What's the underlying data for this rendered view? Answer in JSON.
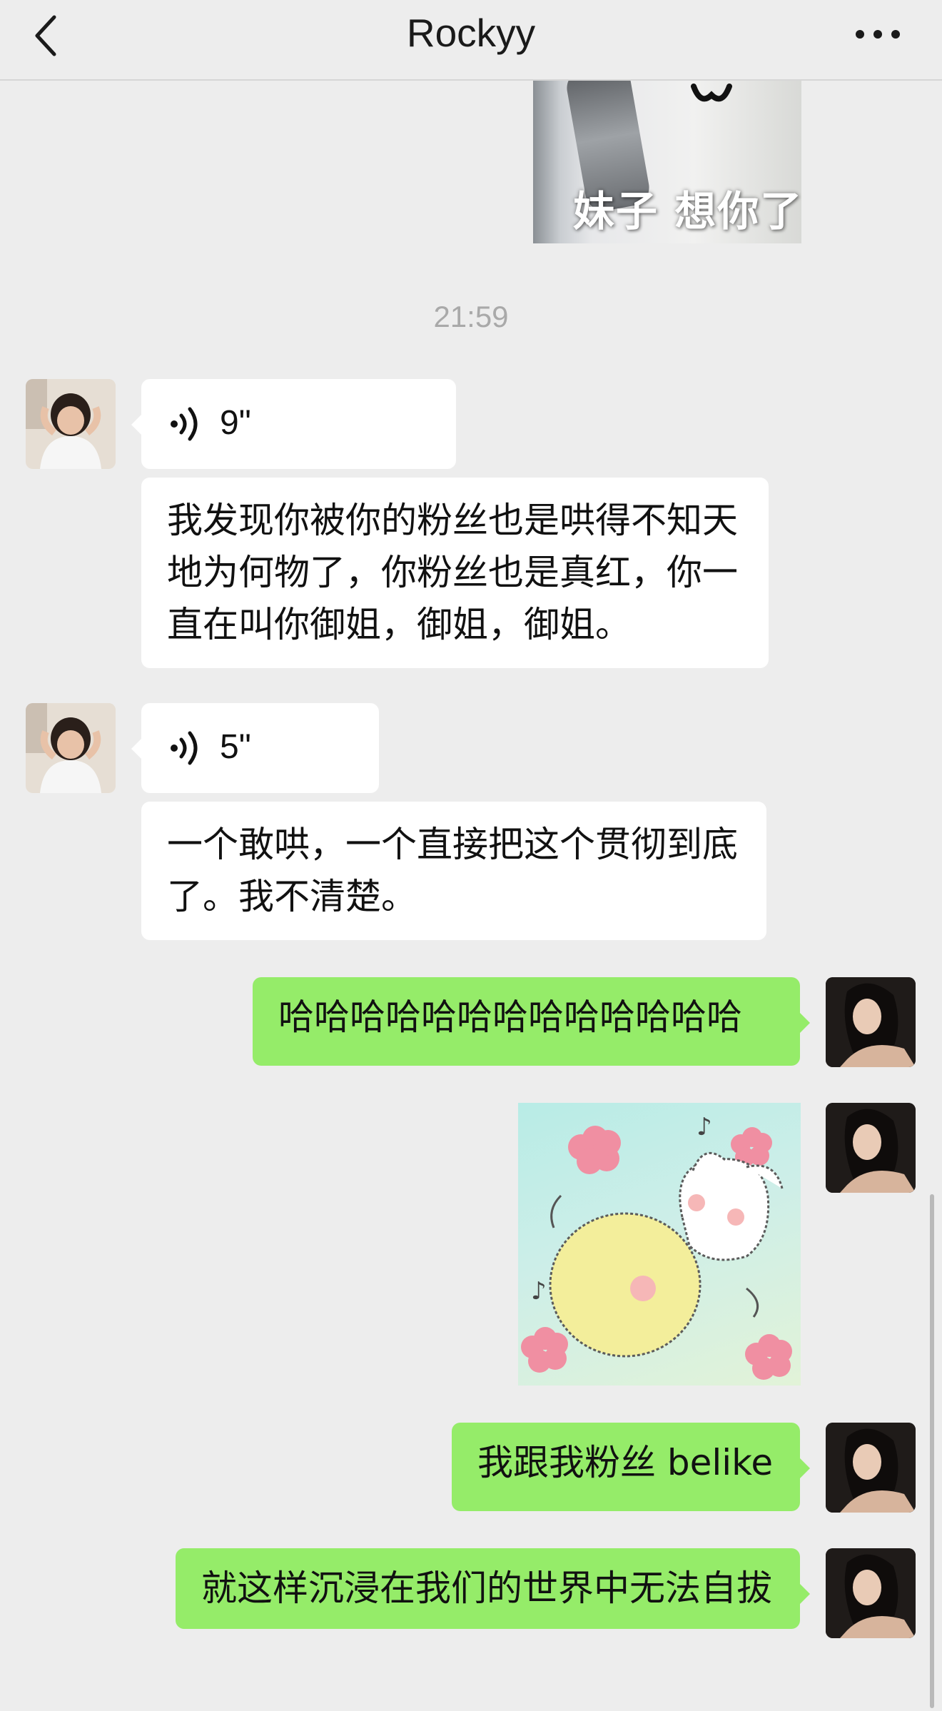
{
  "header": {
    "title": "Rockyy",
    "back_icon": "chevron-left-icon",
    "more_icon": "ellipsis-icon"
  },
  "messages": {
    "sticker_top": {
      "caption": "妹子 想你了"
    },
    "time": "21:59",
    "voice1": {
      "duration": "9\""
    },
    "text1": "我发现你被你的粉丝也是哄得不知天地为何物了，你粉丝也是真红，你一直在叫你御姐，御姐，御姐。",
    "voice2": {
      "duration": "5\""
    },
    "text2": "一个敢哄，一个直接把这个贯彻到底了。我不清楚。",
    "out1": "哈哈哈哈哈哈哈哈哈哈哈哈哈",
    "out2": "我跟我粉丝 belike",
    "out3": "就这样沉浸在我们的世界中无法自拔"
  },
  "colors": {
    "background": "#ededed",
    "incoming_bubble": "#ffffff",
    "outgoing_bubble": "#95ec69",
    "timestamp": "#a9a9a9"
  }
}
